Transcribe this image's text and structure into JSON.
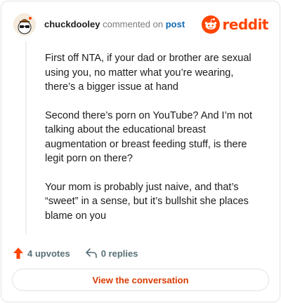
{
  "header": {
    "username": "chuckdooley",
    "action_text": "commented on",
    "post_link": "post",
    "logo_text": "reddit",
    "avatar_icon": "snoo-sunglasses-avatar"
  },
  "comment": {
    "paragraphs": [
      "First off NTA, if your dad or brother are sexual using you, no matter what you’re wearing, there’s a bigger issue at hand",
      "Second there’s porn on YouTube? And I’m not talking about the educational breast augmentation or breast feeding stuff, is there legit porn on there?",
      "Your mom is probably just naive, and that’s “sweet” in a sense, but it’s bullshit she places blame on you"
    ]
  },
  "actions": {
    "upvotes": "4 upvotes",
    "replies": "0 replies"
  },
  "cta": {
    "label": "View the conversation"
  },
  "colors": {
    "brand": "#ff4500",
    "cta_text": "#d93a00",
    "link": "#0f6ab4",
    "muted": "#576f76"
  }
}
